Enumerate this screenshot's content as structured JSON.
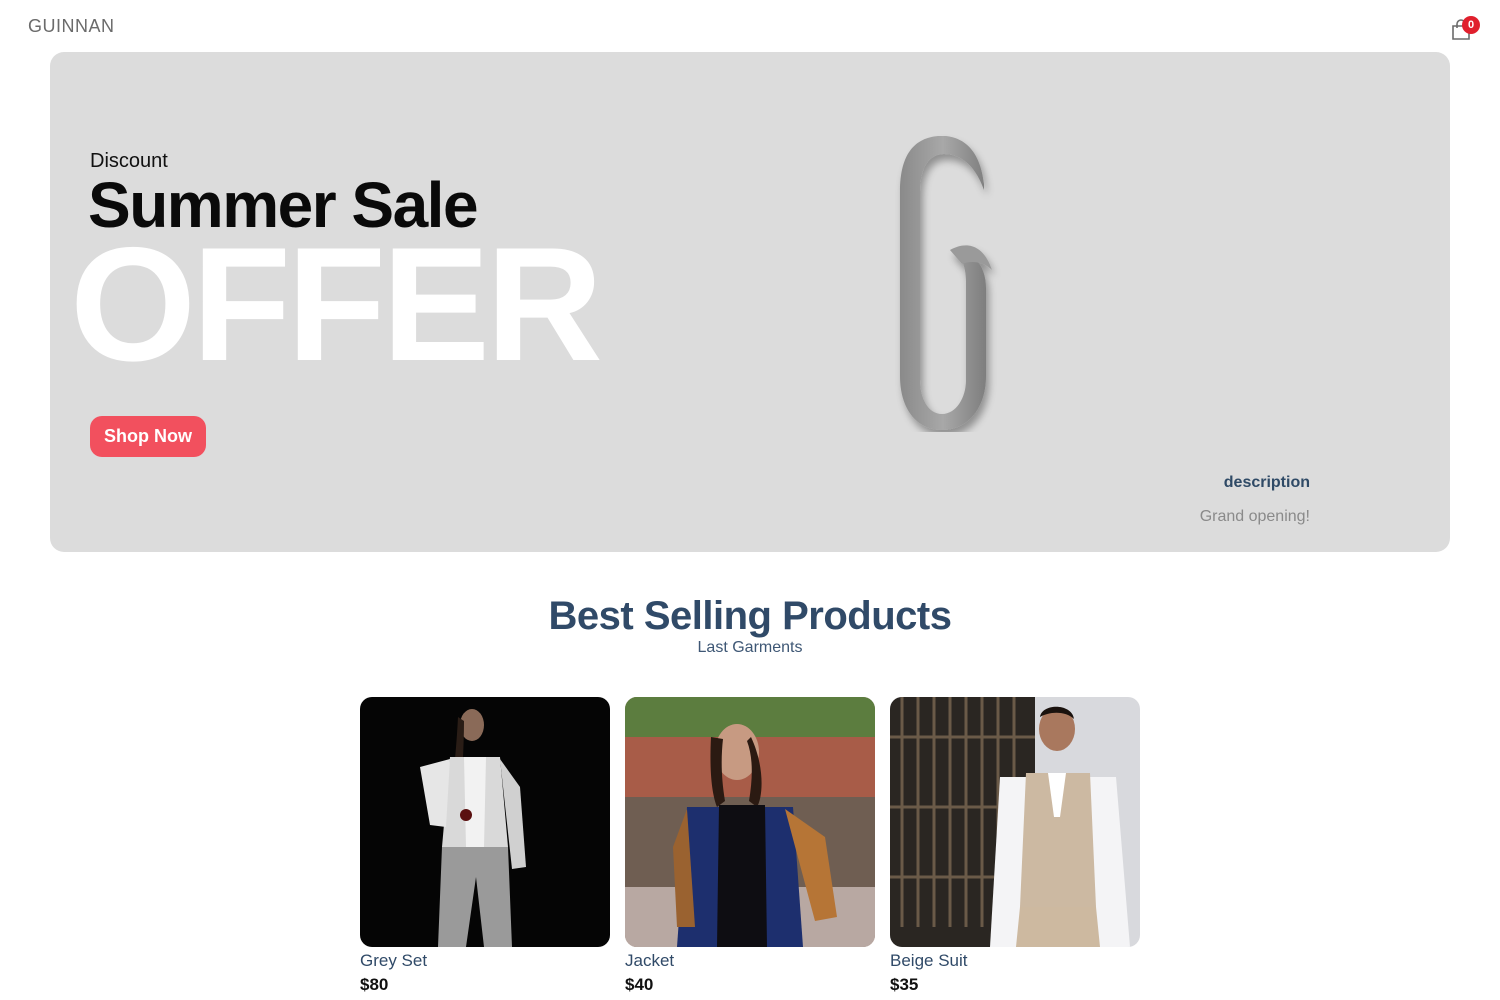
{
  "header": {
    "logo": "GUINNAN",
    "cart_icon": "shopping-bag-icon",
    "cart_count": "0",
    "accent": "#e0202d"
  },
  "hero": {
    "small_text": "Discount",
    "mid_text": "Summer Sale",
    "large_text": "OFFER",
    "button_label": "Shop Now",
    "button_color": "#f2505e",
    "description_title": "description",
    "description_text": "Grand opening!",
    "background": "#dcdcdc"
  },
  "section": {
    "title": "Best Selling Products",
    "subtitle": "Last Garments"
  },
  "products": [
    {
      "name": "Grey Set",
      "price": "$80"
    },
    {
      "name": "Jacket",
      "price": "$40"
    },
    {
      "name": "Beige Suit",
      "price": "$35"
    }
  ]
}
